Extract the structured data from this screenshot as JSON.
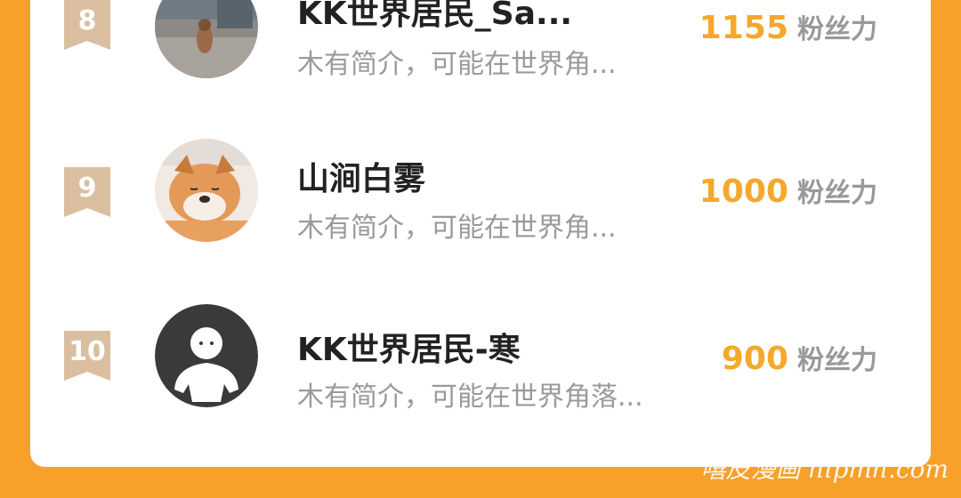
{
  "ranking": {
    "rows": [
      {
        "rank": "8",
        "name": "KK世界居民_Sa...",
        "intro": "木有简介，可能在世界角...",
        "score": "1155",
        "unit": "粉丝力"
      },
      {
        "rank": "9",
        "name": "山涧白雾",
        "intro": "木有简介，可能在世界角...",
        "score": "1000",
        "unit": "粉丝力"
      },
      {
        "rank": "10",
        "name": "KK世界居民-寒",
        "intro": "木有简介，可能在世界角落...",
        "score": "900",
        "unit": "粉丝力"
      }
    ]
  },
  "watermark": "嘻皮漫画 hipmh.com",
  "colors": {
    "background": "#F7A02A",
    "score": "#F4A82C",
    "badge": "#D9BFA0"
  },
  "icons": [
    "rank-ribbon-icon",
    "default-avatar-icon"
  ]
}
